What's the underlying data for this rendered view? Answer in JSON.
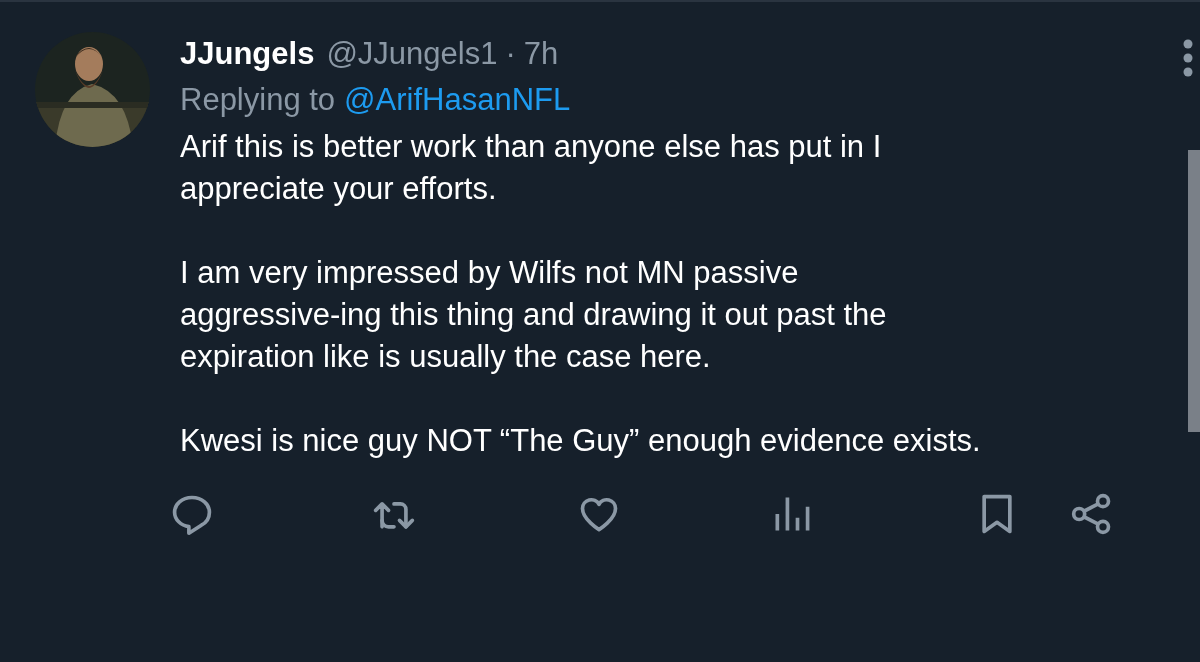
{
  "tweet": {
    "author": {
      "name": "JJungels",
      "handle": "@JJungels1",
      "separator": "·",
      "time": "7h"
    },
    "reply_to": {
      "label": "Replying to",
      "mention": "@ArifHasanNFL"
    },
    "paragraphs": [
      "Arif this is better work than anyone else has put in I\nappreciate your efforts.",
      "I am very impressed by Wilfs not MN passive\naggressive-ing this thing and drawing it out past the\nexpiration like is usually the case here.",
      "Kwesi is nice guy NOT “The Guy” enough evidence exists."
    ],
    "actions": [
      {
        "kind": "reply"
      },
      {
        "kind": "repost"
      },
      {
        "kind": "like"
      },
      {
        "kind": "views"
      },
      {
        "kind": "bookmark"
      },
      {
        "kind": "share"
      }
    ]
  }
}
